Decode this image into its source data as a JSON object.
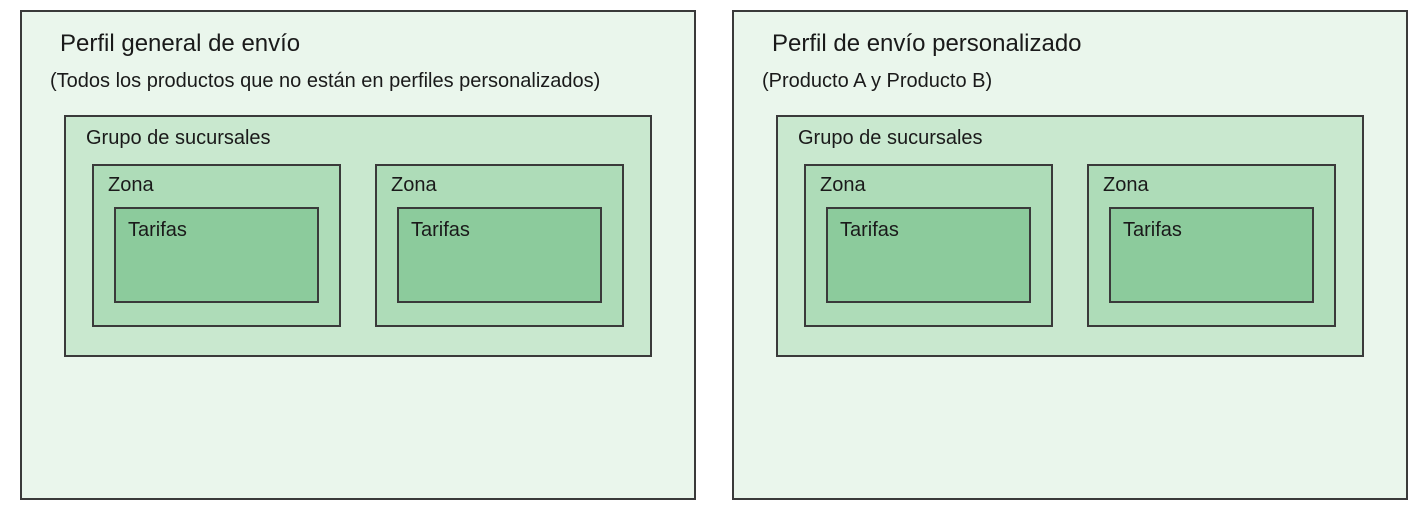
{
  "profiles": [
    {
      "title": "Perfil general de envío",
      "subtitle": "(Todos los productos que no están en perfiles personalizados)",
      "group": {
        "label": "Grupo de sucursales",
        "zones": [
          {
            "label": "Zona",
            "rates_label": "Tarifas"
          },
          {
            "label": "Zona",
            "rates_label": "Tarifas"
          }
        ]
      }
    },
    {
      "title": "Perfil de envío personalizado",
      "subtitle": "(Producto A y Producto B)",
      "group": {
        "label": "Grupo de sucursales",
        "zones": [
          {
            "label": "Zona",
            "rates_label": "Tarifas"
          },
          {
            "label": "Zona",
            "rates_label": "Tarifas"
          }
        ]
      }
    }
  ]
}
